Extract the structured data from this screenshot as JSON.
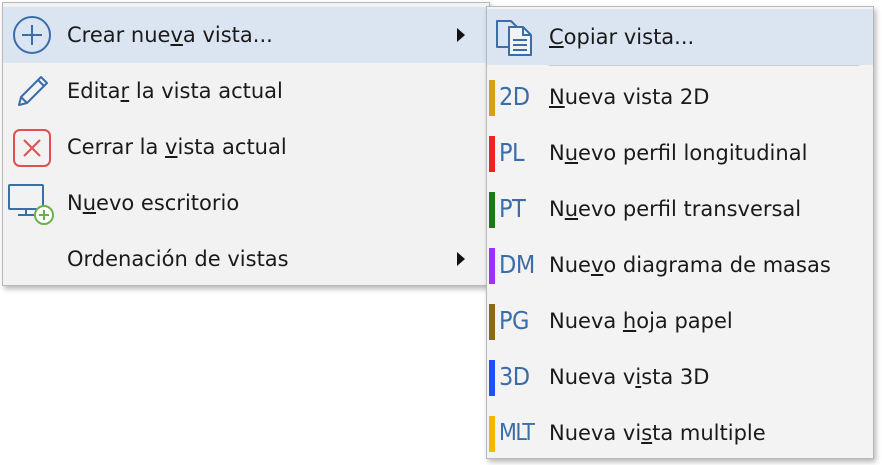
{
  "main_menu": {
    "items": [
      {
        "pre": "Crear nue",
        "u": "v",
        "post": "a vista...",
        "icon": "add-circle-icon",
        "submenu": true,
        "highlighted": true
      },
      {
        "pre": "Edita",
        "u": "r",
        "post": " la vista actual",
        "icon": "pencil-icon"
      },
      {
        "pre": "Cerrar la ",
        "u": "v",
        "post": "ista actual",
        "icon": "close-box-icon"
      },
      {
        "pre": "N",
        "u": "u",
        "post": "evo escritorio",
        "icon": "monitor-add-icon"
      },
      {
        "pre": "Ordenación de vistas",
        "u": "",
        "post": "",
        "icon": "",
        "submenu": true
      }
    ]
  },
  "sub_menu": {
    "copy": {
      "pre": "",
      "u": "C",
      "post": "opiar vista...",
      "icon": "copy-document-icon"
    },
    "items": [
      {
        "code": "2D",
        "color": "#d4a017",
        "pre": "",
        "u": "N",
        "post": "ueva vista 2D"
      },
      {
        "code": "PL",
        "color": "#ee2222",
        "pre": "N",
        "u": "u",
        "post": "evo perfil longitudinal"
      },
      {
        "code": "PT",
        "color": "#1a7a1a",
        "pre": "N",
        "u": "u",
        "post": "evo perfil transversal"
      },
      {
        "code": "DM",
        "color": "#9b30ff",
        "pre": "Nue",
        "u": "v",
        "post": "o diagrama de masas"
      },
      {
        "code": "PG",
        "color": "#8b6914",
        "pre": "Nueva ",
        "u": "h",
        "post": "oja papel"
      },
      {
        "code": "3D",
        "color": "#1f4fff",
        "pre": "Nueva v",
        "u": "i",
        "post": "sta 3D"
      },
      {
        "code": "MLT",
        "color": "#f5b800",
        "pre": "Nueva vi",
        "u": "s",
        "post": "ta multiple"
      }
    ]
  },
  "colors": {
    "highlight": "#dbe5f1",
    "icon_blue": "#3b6ea8",
    "icon_red": "#e05050",
    "icon_green": "#6ab04c"
  }
}
